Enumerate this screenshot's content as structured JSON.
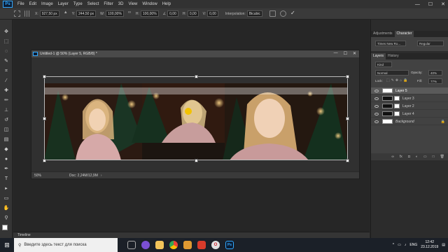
{
  "app": {
    "logo_text": "Ps",
    "brand_color": "#31a8ff"
  },
  "menu": [
    "File",
    "Edit",
    "Image",
    "Layer",
    "Type",
    "Select",
    "Filter",
    "3D",
    "View",
    "Window",
    "Help"
  ],
  "window_controls": {
    "minimize": "—",
    "maximize": "☐",
    "close": "✕"
  },
  "options_bar": {
    "x_label": "X:",
    "x_value": "927,50 px",
    "y_label": "Y:",
    "y_value": "244,50 px",
    "w_label": "W:",
    "w_value": "100,00%",
    "h_label": "H:",
    "h_value": "100,00%",
    "angle_label": "∠",
    "angle_value": "0,00",
    "hskew_label": "H:",
    "hskew_value": "0,00",
    "vskew_label": "V:",
    "vskew_value": "0,00",
    "interpolation_label": "Interpolation:",
    "interpolation_value": "Bicubic"
  },
  "document": {
    "title": "Untitled-1 @ 50% (Layer 5, RGB/8) *",
    "zoom": "50%",
    "doc_info": "Doc: 2,24M/12,9M"
  },
  "panels": {
    "top_tabs": [
      "Adjustments",
      "Character"
    ],
    "font_family": "Times New Ro...",
    "font_style": "Regular",
    "layer_tabs": [
      "Layers",
      "History"
    ],
    "kind_label": "Kind",
    "blend_mode": "Normal",
    "opacity_label": "Opacity:",
    "opacity_value": "40%",
    "lock_label": "Lock:",
    "fill_label": "Fill:",
    "fill_value": "77%",
    "layers": [
      {
        "name": "Layer 5",
        "selected": true
      },
      {
        "name": "Layer 3",
        "selected": false
      },
      {
        "name": "Layer 2",
        "selected": false
      },
      {
        "name": "Layer 4",
        "selected": false
      },
      {
        "name": "Background",
        "selected": false
      }
    ],
    "footer_icons": [
      "link",
      "fx",
      "mask",
      "adjust",
      "group",
      "new",
      "trash"
    ]
  },
  "timeline": {
    "label": "Timeline"
  },
  "taskbar": {
    "search_placeholder": "Введите здесь текст для поиска",
    "apps": [
      "task-view",
      "cortana",
      "explorer",
      "chrome",
      "gallery",
      "pdf",
      "opera",
      "photoshop"
    ],
    "language": "ENG",
    "time": "12:42",
    "date": "23.12.2019"
  }
}
